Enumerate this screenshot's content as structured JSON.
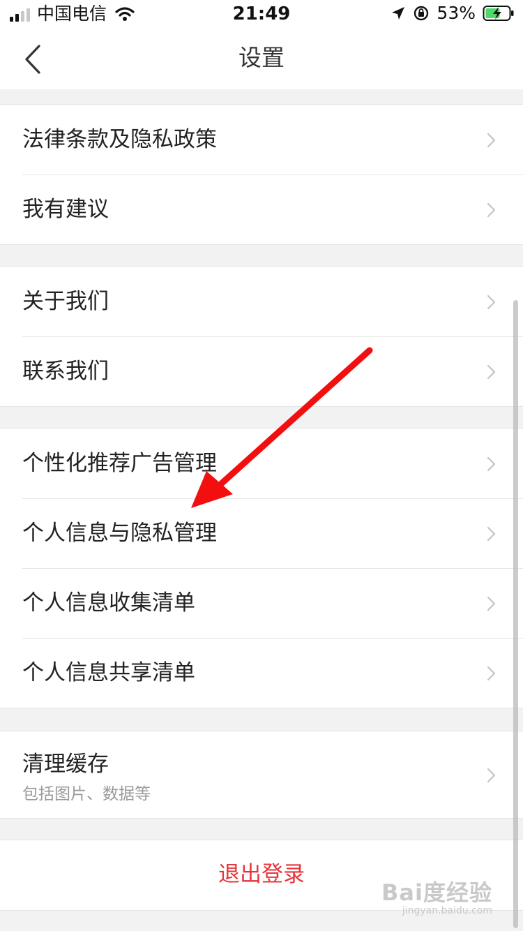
{
  "status_bar": {
    "carrier": "中国电信",
    "time": "21:49",
    "battery": "53%",
    "icons": [
      "signal-icon",
      "wifi-icon",
      "location-icon",
      "rotation-lock-icon",
      "battery-charging-icon"
    ]
  },
  "header": {
    "title": "设置",
    "back_icon": "chevron-left-icon"
  },
  "groups": [
    {
      "items": [
        {
          "label": "法律条款及隐私政策"
        },
        {
          "label": "我有建议"
        }
      ]
    },
    {
      "items": [
        {
          "label": "关于我们"
        },
        {
          "label": "联系我们"
        }
      ]
    },
    {
      "items": [
        {
          "label": "个性化推荐广告管理"
        },
        {
          "label": "个人信息与隐私管理"
        },
        {
          "label": "个人信息收集清单"
        },
        {
          "label": "个人信息共享清单"
        }
      ]
    },
    {
      "items": [
        {
          "label": "清理缓存",
          "sub": "包括图片、数据等"
        }
      ]
    }
  ],
  "logout": {
    "label": "退出登录"
  },
  "colors": {
    "accent_red": "#e8333a",
    "arrow_red": "#f20f0f",
    "background": "#f2f2f2"
  },
  "watermark": {
    "main": "Bai度经验",
    "sub": "jingyan.baidu.com"
  }
}
